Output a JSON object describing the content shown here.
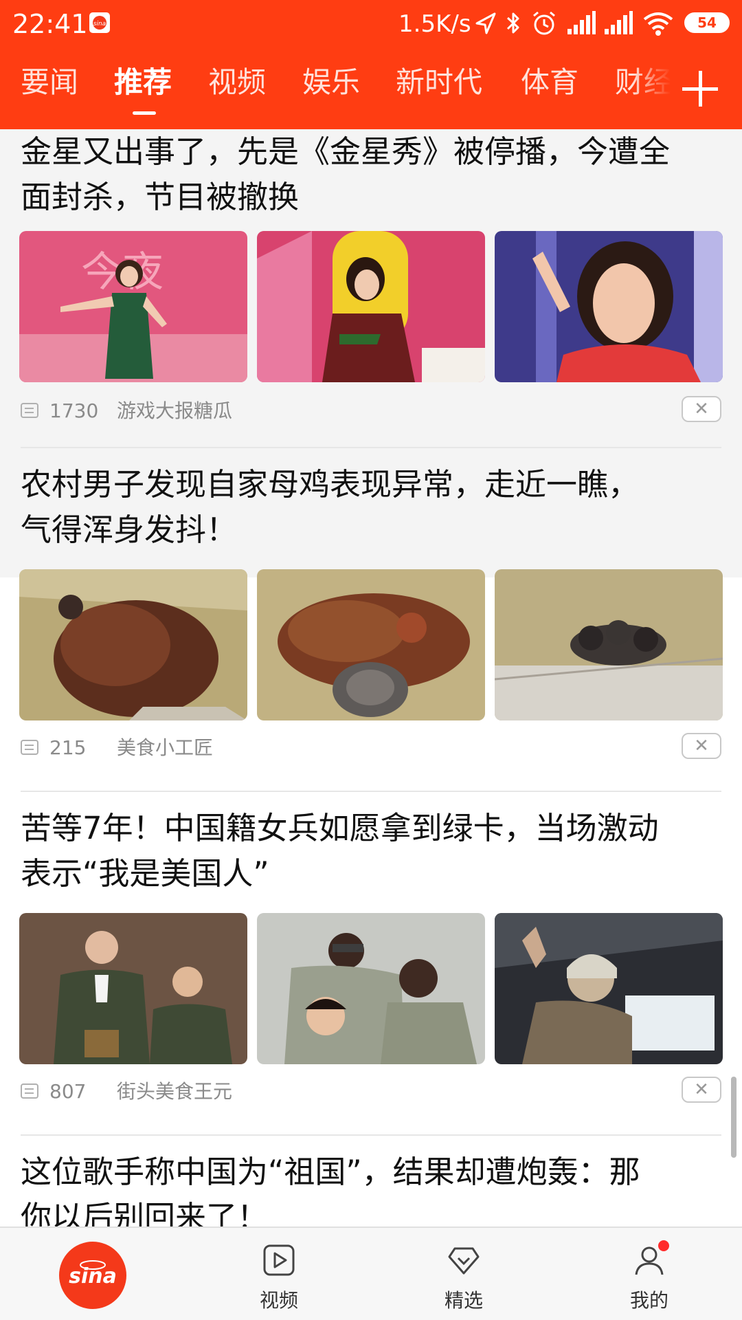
{
  "status_bar": {
    "time": "22:41",
    "net_speed": "1.5K/s",
    "battery": "54",
    "icons": [
      "location-icon",
      "bluetooth-icon",
      "alarm-icon",
      "signal-icon",
      "signal-icon",
      "wifi-icon"
    ]
  },
  "tabs": [
    {
      "label": "要闻",
      "active": false
    },
    {
      "label": "推荐",
      "active": true
    },
    {
      "label": "视频",
      "active": false
    },
    {
      "label": "娱乐",
      "active": false
    },
    {
      "label": "新时代",
      "active": false
    },
    {
      "label": "体育",
      "active": false
    },
    {
      "label": "财经",
      "active": false
    }
  ],
  "feed": [
    {
      "title_lines": [
        "金星又出事了，先是《金星秀》被停播，今遭全",
        "面封杀，节目被撤换"
      ],
      "comments": "1730",
      "source": "游戏大报糖瓜",
      "thumbs": [
        "woman-green-dress-stage",
        "woman-seated-talk-show",
        "woman-pointing-red-dress"
      ]
    },
    {
      "title_lines": [
        "农村男子发现自家母鸡表现异常，走近一瞧，",
        "气得浑身发抖！"
      ],
      "comments": "215",
      "source": "美食小工匠",
      "thumbs": [
        "hen-in-straw-nest",
        "hen-with-kitten",
        "kittens-in-straw"
      ]
    },
    {
      "title_lines": [
        "苦等7年！中国籍女兵如愿拿到绿卡，当场激动",
        "表示“我是美国人”"
      ],
      "comments": "807",
      "source": "街头美食王元",
      "thumbs": [
        "soldiers-ceremony",
        "soldiers-group",
        "soldier-helicopter"
      ]
    },
    {
      "title_lines": [
        "这位歌手称中国为“祖国”，结果却遭炮轰：那",
        "你以后别回来了！"
      ]
    }
  ],
  "dislike_symbol": "✕",
  "bottom_nav": {
    "home_logo": "sina",
    "video_label": "视频",
    "featured_label": "精选",
    "me_label": "我的"
  },
  "colors": {
    "brand": "#ff3d12",
    "badge": "#ff2b2b"
  }
}
